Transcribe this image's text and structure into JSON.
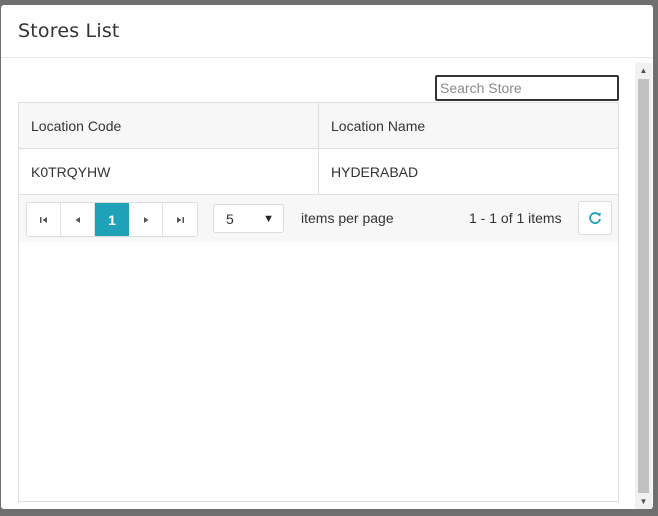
{
  "modal": {
    "title": "Stores List"
  },
  "search": {
    "placeholder": "Search Store",
    "value": ""
  },
  "table": {
    "columns": [
      "Location Code",
      "Location Name"
    ],
    "rows": [
      {
        "code": "K0TRQYHW",
        "name": "HYDERABAD"
      }
    ]
  },
  "pager": {
    "first_icon": "first-page-icon",
    "prev_icon": "prev-page-icon",
    "current_page": "1",
    "next_icon": "next-page-icon",
    "last_icon": "last-page-icon",
    "page_size": "5",
    "items_per_page_label": "items per page",
    "info": "1 - 1 of 1 items",
    "refresh_icon": "refresh-icon"
  },
  "colors": {
    "accent": "#1fa1b8",
    "header_bg": "#f7f7f8"
  }
}
